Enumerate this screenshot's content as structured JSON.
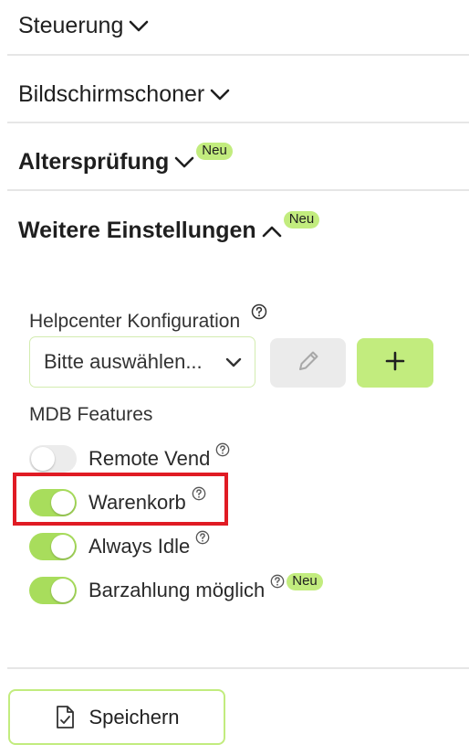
{
  "sections": [
    {
      "title": "Steuerung",
      "expanded": false,
      "badge": ""
    },
    {
      "title": "Bildschirmschoner",
      "expanded": false,
      "badge": ""
    },
    {
      "title": "Altersprüfung",
      "expanded": false,
      "badge": "Neu"
    },
    {
      "title": "Weitere Einstellungen",
      "expanded": true,
      "badge": "Neu"
    }
  ],
  "helpcenter": {
    "label": "Helpcenter Konfiguration",
    "select_value": "Bitte auswählen..."
  },
  "features": {
    "label": "MDB Features",
    "items": [
      {
        "label": "Remote Vend",
        "enabled": false,
        "badge": ""
      },
      {
        "label": "Warenkorb",
        "enabled": true,
        "badge": ""
      },
      {
        "label": "Always Idle",
        "enabled": true,
        "badge": ""
      },
      {
        "label": "Barzahlung möglich",
        "enabled": true,
        "badge": "Neu"
      }
    ]
  },
  "save_label": "Speichern",
  "colors": {
    "accent": "#c2ec7e",
    "toggle_on": "#a8dd5c",
    "highlight": "#e01b24"
  }
}
